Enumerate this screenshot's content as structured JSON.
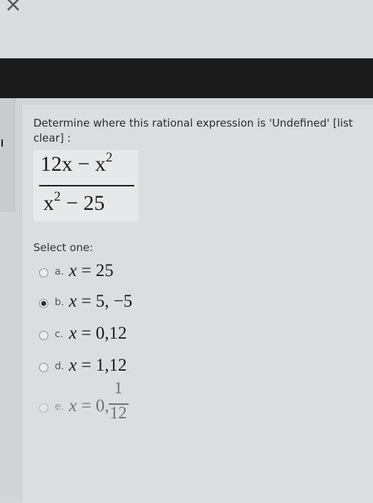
{
  "window": {
    "close_glyph": "×"
  },
  "question": {
    "text": "Determine where this rational expression is 'Undefined' [list clear] :",
    "expression": {
      "num_a": "12x − x",
      "num_exp": "2",
      "den_a": "x",
      "den_exp": "2",
      "den_b": " − 25"
    }
  },
  "select_label": "Select one:",
  "options": [
    {
      "letter": "a.",
      "lhs": "x",
      "rhs": " = 25",
      "selected": false
    },
    {
      "letter": "b.",
      "lhs": "x",
      "rhs": " = 5, −5",
      "selected": true
    },
    {
      "letter": "c.",
      "lhs": "x",
      "rhs": " = 0,12",
      "selected": false
    },
    {
      "letter": "d.",
      "lhs": "x",
      "rhs": " = 1,12",
      "selected": false
    },
    {
      "letter": "e.",
      "lhs": "x",
      "rhs": " = 0,",
      "frac_num": "1",
      "frac_den": "12",
      "selected": false
    }
  ]
}
